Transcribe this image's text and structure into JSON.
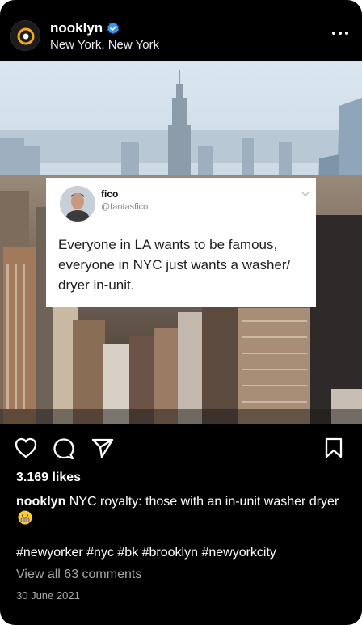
{
  "post": {
    "username": "nooklyn",
    "location": "New York, New York",
    "likes": "3.169 likes",
    "caption_user": "nooklyn",
    "caption_text": "NYC royalty: those with an in-unit washer dryer",
    "hashtags": "#newyorker #nyc #bk #brooklyn #newyorkcity",
    "view_comments": "View all 63 comments",
    "date": "30 June 2021"
  },
  "tweet": {
    "name": "fico",
    "handle": "@fantasfico",
    "line1": "Everyone in LA wants to be famous,",
    "line2": "everyone in NYC just wants a washer/",
    "line3": "dryer in-unit."
  },
  "colors": {
    "background": "#000000",
    "verified": "#3897f0",
    "secondary_text": "#a8a8a8",
    "logo_orange": "#f5a623"
  },
  "icons": [
    "verified-badge-icon",
    "more-options-icon",
    "heart-icon",
    "comment-icon",
    "share-icon",
    "bookmark-icon",
    "chevron-down-icon",
    "grimacing-emoji-icon"
  ]
}
